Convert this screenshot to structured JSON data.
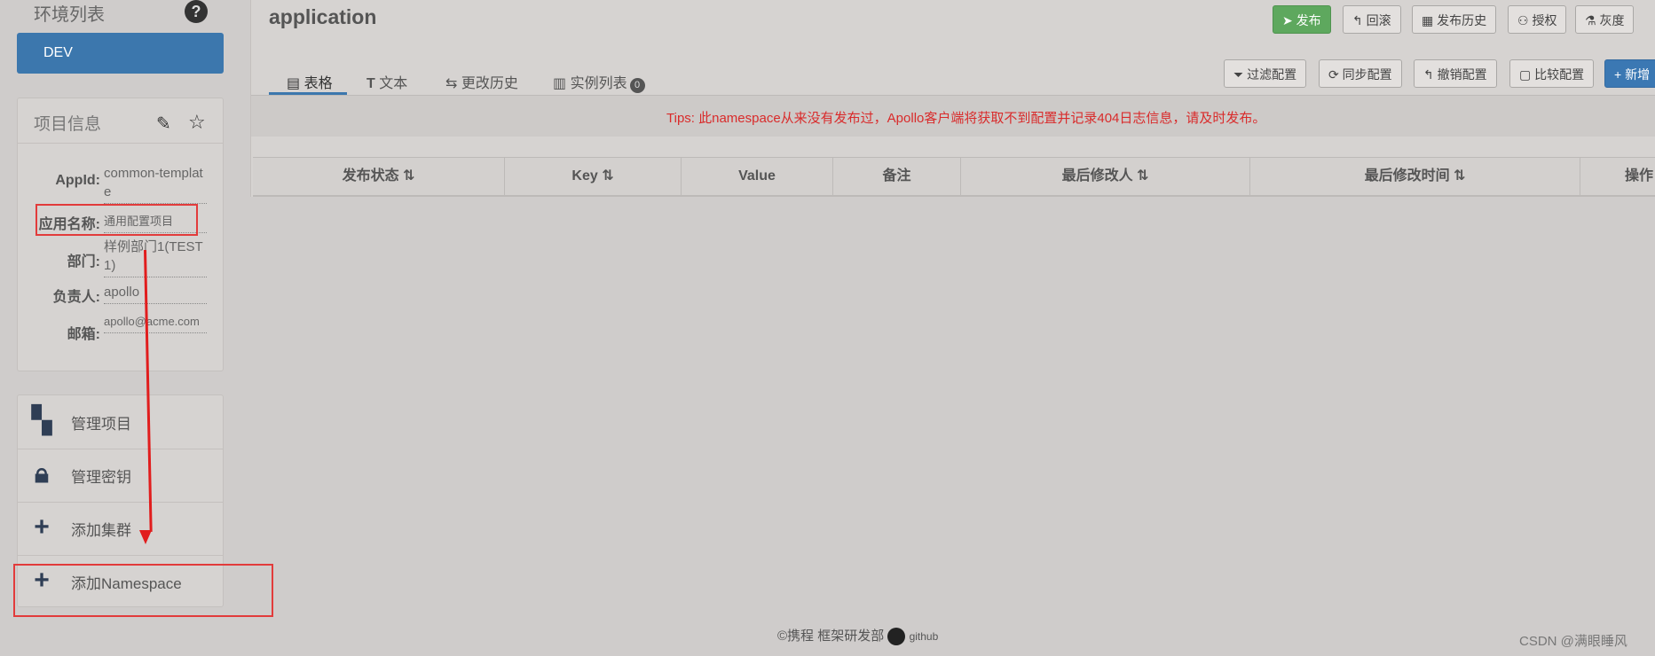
{
  "sidebar": {
    "env_title": "环境列表",
    "env_item": "DEV",
    "project_info_title": "项目信息",
    "info": {
      "appid_label": "AppId:",
      "appid_value": "common-template",
      "app_name_label": "应用名称:",
      "app_name_value": "通用配置项目",
      "dept_label": "部门:",
      "dept_value": "样例部门1(TEST1)",
      "owner_label": "负责人:",
      "owner_value": "apollo",
      "email_label": "邮箱:",
      "email_value": "apollo@acme.com"
    },
    "menu": [
      {
        "label": "管理项目",
        "icon": "dashboard-icon"
      },
      {
        "label": "管理密钥",
        "icon": "lock-icon"
      },
      {
        "label": "添加集群",
        "icon": "plus-icon"
      },
      {
        "label": "添加Namespace",
        "icon": "plus-icon"
      }
    ]
  },
  "main": {
    "namespace_title": "application",
    "top_buttons": {
      "publish": "发布",
      "rollback": "回滚",
      "history": "发布历史",
      "authorize": "授权",
      "gray": "灰度"
    },
    "tabs": {
      "table": "表格",
      "text": "文本",
      "history": "更改历史",
      "instances": "实例列表",
      "instances_count": "0"
    },
    "tool_buttons": {
      "filter": "过滤配置",
      "sync": "同步配置",
      "revoke": "撤销配置",
      "compare": "比较配置",
      "add": "新增"
    },
    "tips": "Tips: 此namespace从来没有发布过，Apollo客户端将获取不到配置并记录404日志信息，请及时发布。",
    "table_headers": [
      "发布状态",
      "Key",
      "Value",
      "备注",
      "最后修改人",
      "最后修改时间",
      "操作"
    ]
  },
  "footer": {
    "copyright": "©携程 框架研发部",
    "github": "github"
  },
  "watermark": "CSDN @满眼睡风",
  "colors": {
    "accent_blue": "#3c77ad",
    "publish_green": "#5ea85e",
    "tips_red": "#d92b2b",
    "annotation_red": "#e11d1d"
  }
}
